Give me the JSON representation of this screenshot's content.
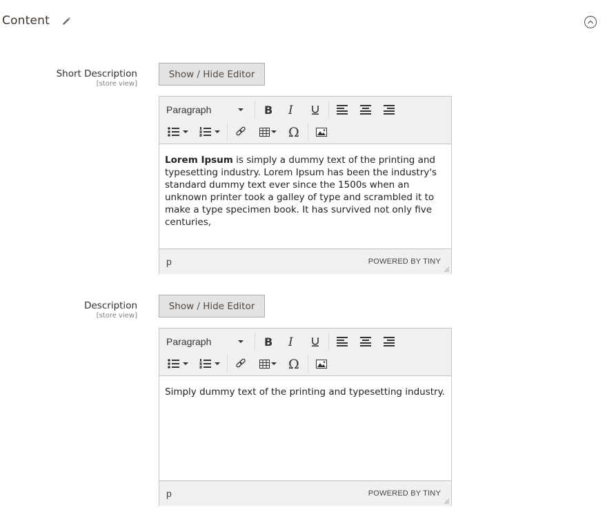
{
  "section": {
    "title": "Content",
    "edit_icon": "pencil-icon",
    "collapse_icon": "chevron-up-circle-icon"
  },
  "fields": [
    {
      "label": "Short Description",
      "scope": "[store view]",
      "toggle_label": "Show / Hide Editor",
      "editor": {
        "format_select": "Paragraph",
        "toolbar_icons": [
          "bold-icon",
          "italic-icon",
          "underline-icon",
          "align-left-icon",
          "align-center-icon",
          "align-right-icon",
          "bullet-list-icon",
          "numbered-list-icon",
          "link-icon",
          "table-icon",
          "special-character-icon",
          "image-icon"
        ],
        "content_bold": "Lorem Ipsum",
        "content_rest": " is simply a dummy text of the printing and typesetting industry. Lorem Ipsum has been the industry's standard dummy text ever since the 1500s when an unknown printer took a galley of type and scrambled it to make a type specimen book. It has survived not only five centuries,",
        "path": "p",
        "branding": "POWERED BY TINY"
      }
    },
    {
      "label": "Description",
      "scope": "[store view]",
      "toggle_label": "Show / Hide Editor",
      "editor": {
        "format_select": "Paragraph",
        "toolbar_icons": [
          "bold-icon",
          "italic-icon",
          "underline-icon",
          "align-left-icon",
          "align-center-icon",
          "align-right-icon",
          "bullet-list-icon",
          "numbered-list-icon",
          "link-icon",
          "table-icon",
          "special-character-icon",
          "image-icon"
        ],
        "content_text": "Simply dummy text of the printing and typesetting industry.",
        "path": "p",
        "branding": "POWERED BY TINY"
      }
    }
  ]
}
